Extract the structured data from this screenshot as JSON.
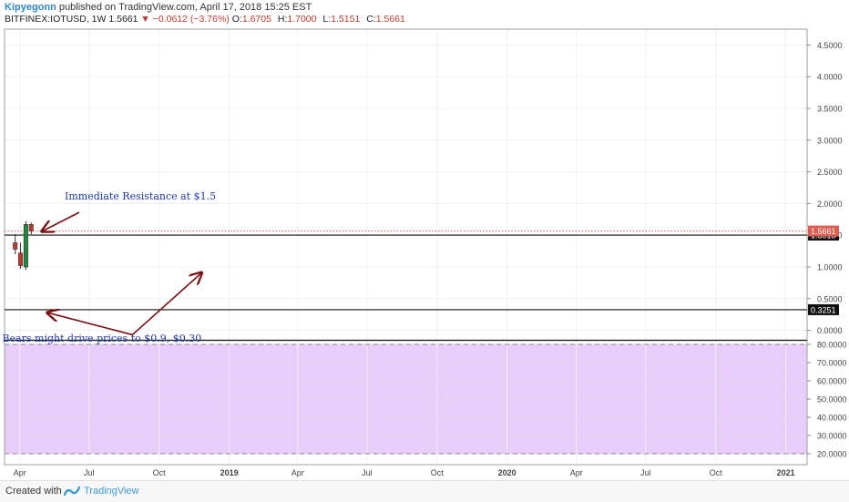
{
  "header": {
    "author": "Kipyegonn",
    "published_text": "published on TradingView.com, April 17, 2018 15:25 EST",
    "symbol": "BITFINEX:IOTUSD, 1W",
    "last": "1.5661",
    "change": "−0.0612 (−3.76%)",
    "open_label": "O:",
    "open": "1.6705",
    "high_label": "H:",
    "high": "1.7000",
    "low_label": "L:",
    "low": "1.5151",
    "close_label": "C:",
    "close": "1.5661"
  },
  "footer": {
    "created_text": "Created with",
    "brand": "TradingView"
  },
  "colors": {
    "up": "#1e8a3c",
    "down": "#c0392b",
    "stoch_band": "#e8ccfa",
    "annotation_text": "#1f35a8",
    "arrow": "#7a1010",
    "price_tag": "#e05d52"
  },
  "chart_data": {
    "type": "candlestick",
    "panels": [
      {
        "name": "price",
        "ylim": [
          -0.15,
          4.75
        ],
        "y_ticks": [
          "4.5000",
          "4.0000",
          "3.5000",
          "3.0000",
          "2.5000",
          "2.0000",
          "1.5000",
          "1.0000",
          "0.5000",
          "0.0000"
        ],
        "y_values": [
          4.5,
          4.0,
          3.5,
          3.0,
          2.5,
          2.0,
          1.5,
          1.0,
          0.5,
          0.0
        ],
        "candles": [
          {
            "date": "2018-03-26",
            "o": 1.38,
            "h": 1.52,
            "l": 1.2,
            "c": 1.28
          },
          {
            "date": "2018-04-02",
            "o": 1.22,
            "h": 1.38,
            "l": 0.97,
            "c": 1.02
          },
          {
            "date": "2018-04-09",
            "o": 1.0,
            "h": 1.72,
            "l": 0.95,
            "c": 1.67
          },
          {
            "date": "2018-04-16",
            "o": 1.6705,
            "h": 1.7,
            "l": 1.5151,
            "c": 1.5661
          }
        ],
        "horizontal_lines": [
          {
            "value": 1.5018,
            "label": "1.5018"
          },
          {
            "value": 0.3251,
            "label": "0.3251"
          }
        ],
        "last_price": {
          "value": 1.5661,
          "label": "1.5661"
        },
        "annotations": [
          {
            "text": "Immediate Resistance at $1.5",
            "date": "2018-05-30",
            "value": 2.06
          },
          {
            "text": "Bears might drive prices to $0.9, $0.30",
            "date": "2018-03-09",
            "value": -0.18
          }
        ],
        "arrows": [
          {
            "from": {
              "date": "2018-06-18",
              "value": 1.86
            },
            "to": {
              "date": "2018-04-30",
              "value": 1.56
            }
          },
          {
            "from": {
              "date": "2018-08-27",
              "value": -0.07
            },
            "to": {
              "date": "2018-05-07",
              "value": 0.28
            }
          },
          {
            "from": {
              "date": "2018-08-27",
              "value": -0.07
            },
            "to": {
              "date": "2018-11-26",
              "value": 0.91
            }
          }
        ]
      },
      {
        "name": "stochastic",
        "ylim": [
          14,
          82
        ],
        "y_ticks": [
          "80.0000",
          "70.0000",
          "60.0000",
          "50.0000",
          "40.0000",
          "30.0000",
          "20.0000"
        ],
        "y_values": [
          80,
          70,
          60,
          50,
          40,
          30,
          20
        ],
        "band": [
          20,
          80
        ]
      }
    ],
    "x_ticks": [
      {
        "label": "Apr",
        "date": "2018-04-01"
      },
      {
        "label": "Jul",
        "date": "2018-07-01"
      },
      {
        "label": "Oct",
        "date": "2018-10-01"
      },
      {
        "label": "2019",
        "date": "2019-01-01"
      },
      {
        "label": "Apr",
        "date": "2019-04-01"
      },
      {
        "label": "Jul",
        "date": "2019-07-01"
      },
      {
        "label": "Oct",
        "date": "2019-10-01"
      },
      {
        "label": "2020",
        "date": "2020-01-01"
      },
      {
        "label": "Apr",
        "date": "2020-04-01"
      },
      {
        "label": "Jul",
        "date": "2020-07-01"
      },
      {
        "label": "Oct",
        "date": "2020-10-01"
      },
      {
        "label": "2021",
        "date": "2021-01-01"
      }
    ],
    "xlim": [
      "2018-03-12",
      "2021-01-29"
    ],
    "grid": true
  }
}
